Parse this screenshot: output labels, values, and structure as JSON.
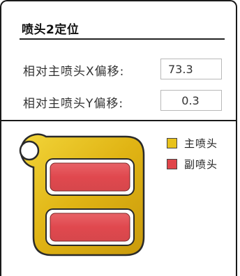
{
  "panel": {
    "title": "喷头2定位"
  },
  "fields": [
    {
      "label": "相对主喷头X偏移:",
      "value": "73.3"
    },
    {
      "label": "相对主喷头Y偏移:",
      "value": "0.3"
    }
  ],
  "legend": [
    {
      "label": "主喷头",
      "color": "#e8c21a"
    },
    {
      "label": "副喷头",
      "color": "#e0454a"
    }
  ],
  "diagram": {
    "body_color": "#e8c21a",
    "nozzle_color": "#e35a5f"
  }
}
